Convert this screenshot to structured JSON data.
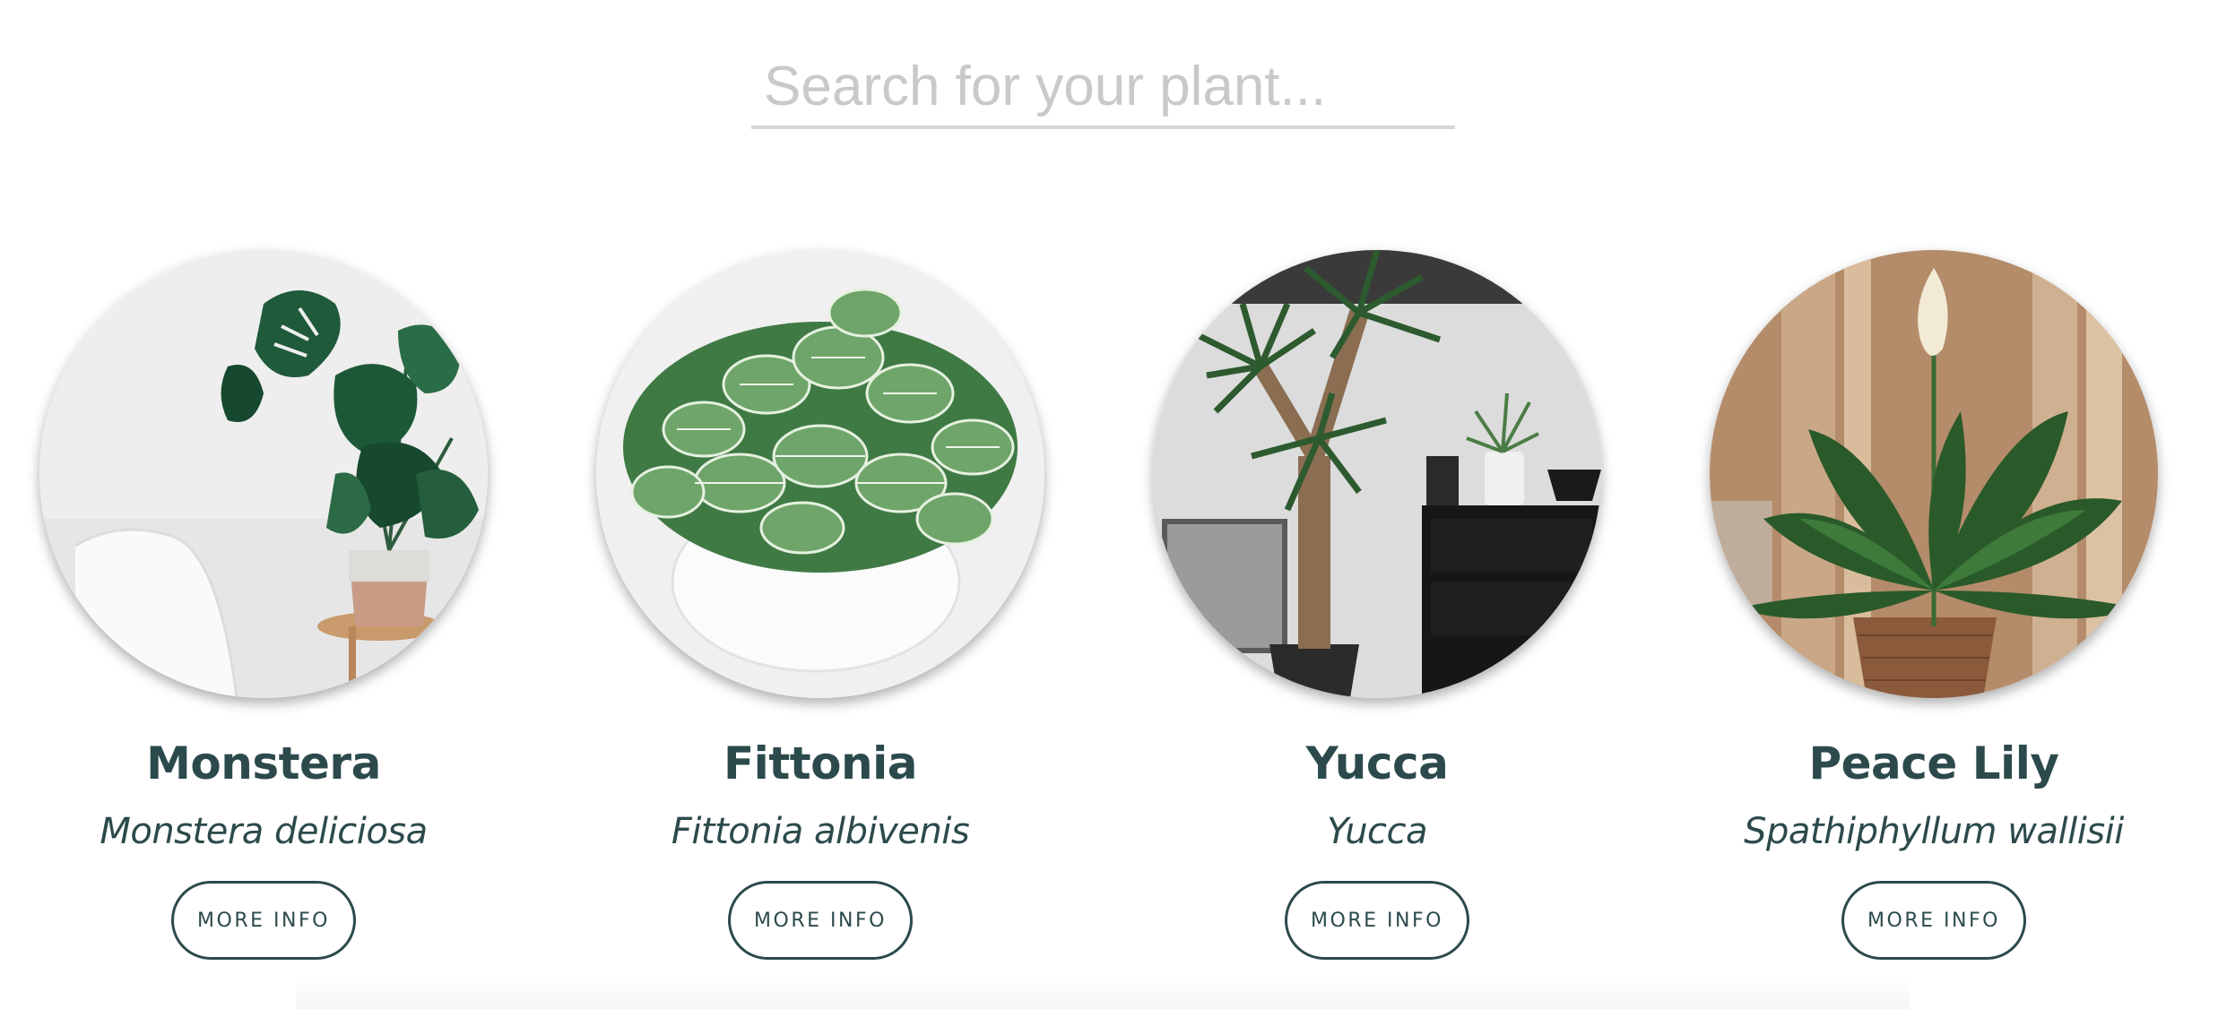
{
  "search": {
    "placeholder": "Search for your plant..."
  },
  "plants": [
    {
      "name": "Monstera",
      "scientific": "Monstera deliciosa",
      "button": "MORE INFO",
      "image": "monstera-photo"
    },
    {
      "name": "Fittonia",
      "scientific": "Fittonia albivenis",
      "button": "MORE INFO",
      "image": "fittonia-photo"
    },
    {
      "name": "Yucca",
      "scientific": "Yucca",
      "button": "MORE INFO",
      "image": "yucca-photo"
    },
    {
      "name": "Peace Lily",
      "scientific": "Spathiphyllum wallisii",
      "button": "MORE INFO",
      "image": "peace-lily-photo"
    }
  ],
  "colors": {
    "accent": "#2c4a4b",
    "search_line": "#d5d5d5",
    "placeholder": "#c9c9c9"
  }
}
